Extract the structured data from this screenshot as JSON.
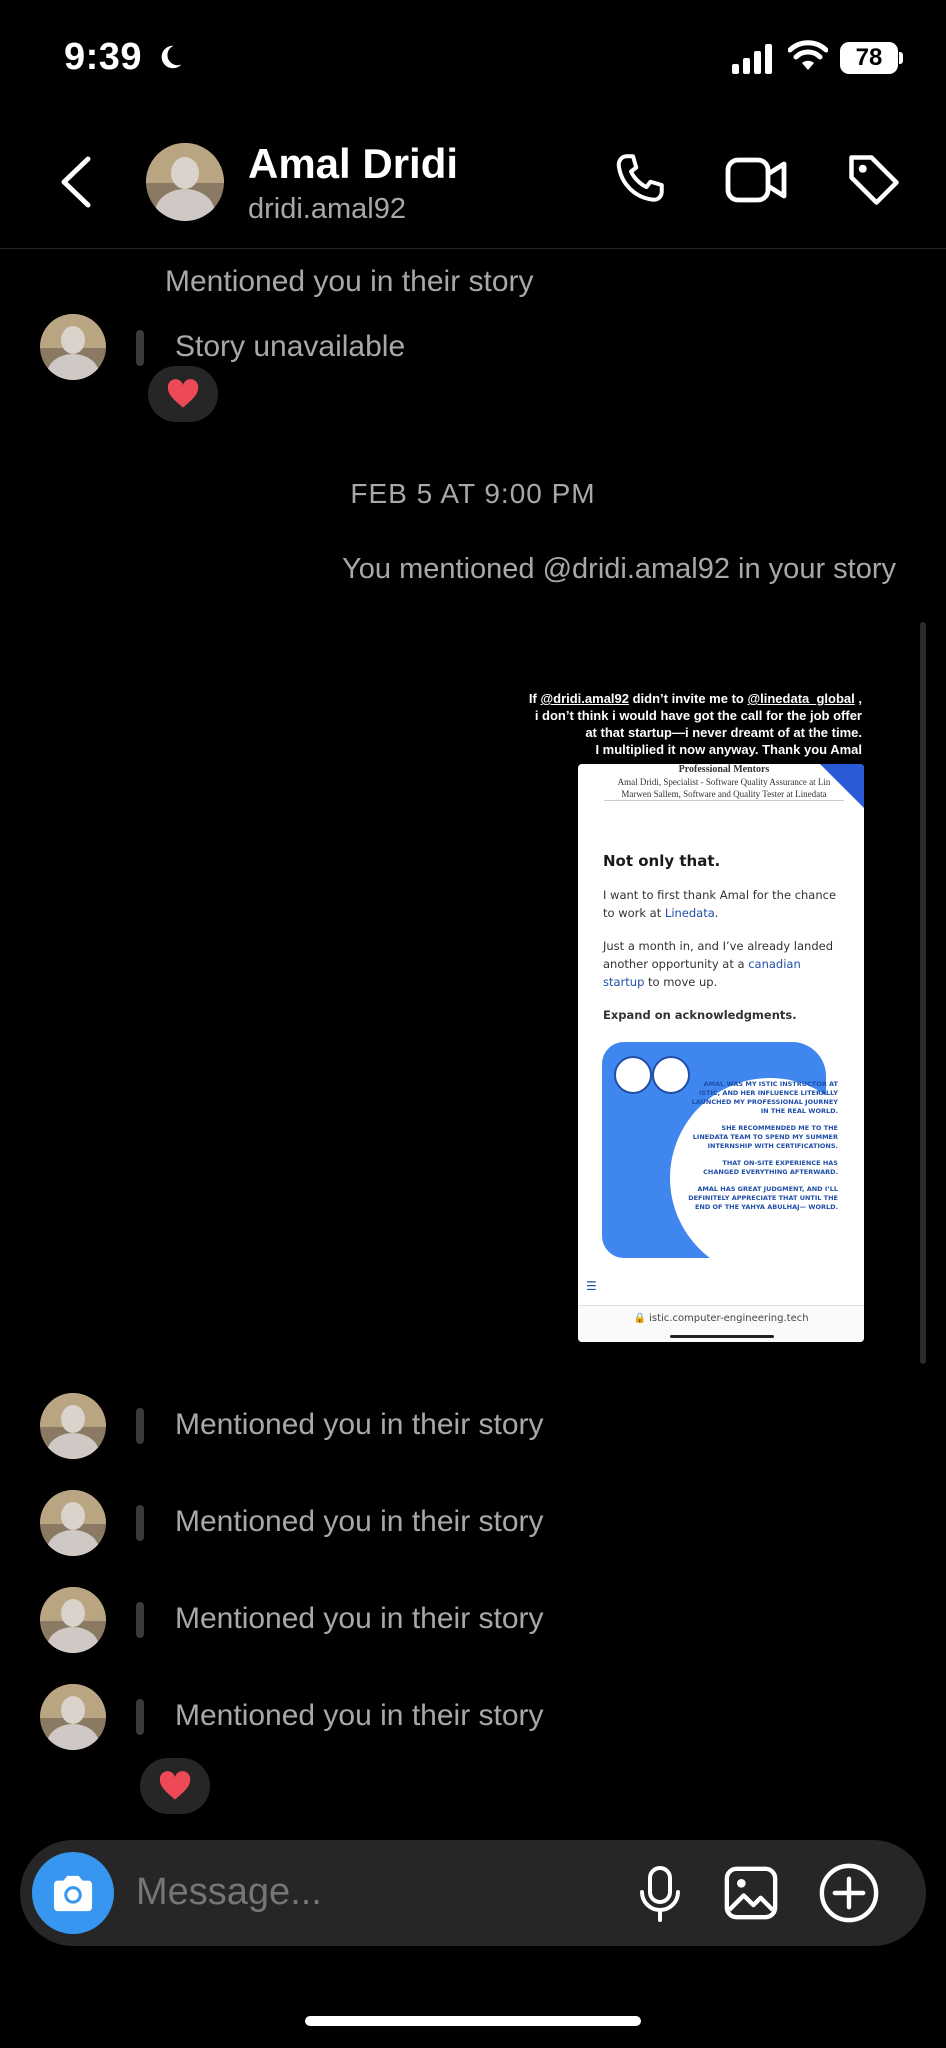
{
  "status_bar": {
    "time": "9:39",
    "battery": "78"
  },
  "header": {
    "name": "Amal Dridi",
    "username": "dridi.amal92"
  },
  "messages": {
    "top_story_label": "Mentioned you in their story",
    "story_unavailable": "Story unavailable",
    "date_divider": "FEB 5 AT 9:00 PM",
    "you_mentioned": "You mentioned @dridi.amal92 in your story",
    "mentions": [
      "Mentioned you in their story",
      "Mentioned you in their story",
      "Mentioned you in their story",
      "Mentioned you in their story"
    ]
  },
  "story": {
    "caption_l1_a": "If ",
    "caption_l1_mention1": "@dridi.amal92",
    "caption_l1_b": " didn’t invite me to ",
    "caption_l1_mention2": "@linedata_global",
    "caption_l1_c": " ,",
    "caption_l2": "i don’t think i would have got the call for the job offer",
    "caption_l3": "at that startup—i never dreamt of at the time.",
    "caption_l4": "I multiplied it now anyway. Thank you Amal",
    "mentors_title": "Professional Mentors",
    "mentors_line1": "Amal Dridi, Specialist - Software Quality Assurance at Lin",
    "mentors_line2": "Marwen Sallem, Software and Quality Tester at Linedata",
    "heading": "Not only that.",
    "para1_a": "I want to first thank Amal for the chance to work at ",
    "para1_link": "Linedata",
    "para1_b": ".",
    "para2_a": "Just a month in, and I’ve already landed another opportunity at a ",
    "para2_link": "canadian startup",
    "para2_b": " to move up.",
    "expand": "Expand on acknowledgments.",
    "quote_1": "AMAL WAS MY ISTIC INSTRUCTOR AT ISTIC, AND HER INFLUENCE LITERALLY LAUNCHED MY PROFESSIONAL JOURNEY IN THE REAL WORLD.",
    "quote_2": "SHE RECOMMENDED ME TO THE LINEDATA TEAM TO SPEND MY SUMMER INTERNSHIP WITH CERTIFICATIONS.",
    "quote_3": "THAT ON-SITE EXPERIENCE HAS CHANGED EVERYTHING AFTERWARD.",
    "quote_4": "AMAL HAS GREAT JUDGMENT, AND I’LL DEFINITELY APPRECIATE THAT UNTIL THE END OF THE YAHYA ABULHAJ— WORLD.",
    "url": "istic.computer-engineering.tech"
  },
  "composer": {
    "placeholder": "Message..."
  },
  "colors": {
    "accent": "#3797f0",
    "heart": "#ed4956",
    "bubble": "#262626"
  }
}
